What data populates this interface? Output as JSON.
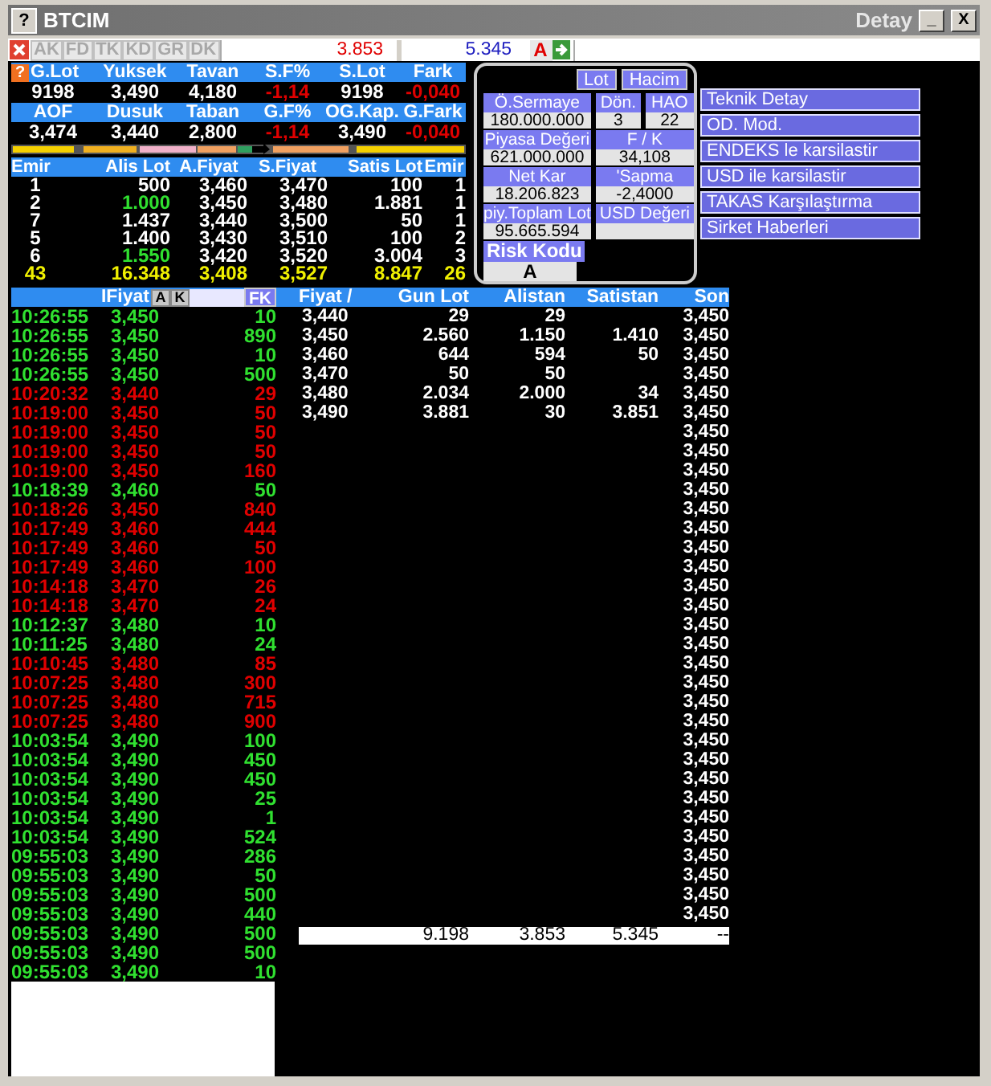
{
  "window": {
    "title": "BTCIM",
    "subtitle": "Detay",
    "help_icon": "?",
    "minimize": "_",
    "close": "X"
  },
  "toolbar": {
    "tabs": [
      {
        "label": "AK",
        "disabled": true
      },
      {
        "label": "FD",
        "disabled": true
      },
      {
        "label": "TK",
        "disabled": true
      },
      {
        "label": "KD",
        "disabled": true
      },
      {
        "label": "GR",
        "disabled": true
      },
      {
        "label": "DK",
        "disabled": true
      }
    ],
    "field_1": "3.853",
    "field_2": "5.345",
    "badge": "A"
  },
  "stats": {
    "help": "?",
    "rows": [
      {
        "headers": [
          "G.Lot",
          "Yuksek",
          "Tavan",
          "S.F%",
          "S.Lot",
          "Fark"
        ],
        "values": [
          "9198",
          "3,490",
          "4,180",
          "-1,14",
          "9198",
          "-0,040"
        ],
        "negative": [
          false,
          false,
          false,
          true,
          false,
          true
        ]
      },
      {
        "headers": [
          "AOF",
          "Dusuk",
          "Taban",
          "G.F%",
          "OG.Kap.",
          "G.Fark"
        ],
        "values": [
          "3,474",
          "3,440",
          "2,800",
          "-1,14",
          "3,490",
          "-0,040"
        ],
        "negative": [
          false,
          false,
          false,
          true,
          false,
          true
        ]
      }
    ]
  },
  "depth": {
    "columns": [
      "Emir",
      "Alis Lot",
      "A.Fiyat",
      "S.Fiyat",
      "Satis Lot",
      "Emir"
    ],
    "rows": [
      {
        "cells": [
          "1",
          "500",
          "3,460",
          "3,470",
          "100",
          "1"
        ],
        "changed": false
      },
      {
        "cells": [
          "2",
          "1.000",
          "3,450",
          "3,480",
          "1.881",
          "1"
        ],
        "changed": true
      },
      {
        "cells": [
          "7",
          "1.437",
          "3,440",
          "3,500",
          "50",
          "1"
        ],
        "changed": false
      },
      {
        "cells": [
          "5",
          "1.400",
          "3,430",
          "3,510",
          "100",
          "2"
        ],
        "changed": false
      },
      {
        "cells": [
          "6",
          "1.550",
          "3,420",
          "3,520",
          "3.004",
          "3"
        ],
        "changed": true
      }
    ],
    "totals": [
      "43",
      "16.348",
      "3,408",
      "3,527",
      "8.847",
      "26"
    ]
  },
  "info": {
    "buttons": [
      {
        "label": "Lot",
        "selected": false
      },
      {
        "label": "Hacim",
        "selected": false
      }
    ],
    "fields": [
      {
        "label": "Ö.Sermaye",
        "value": "180.000.000"
      },
      {
        "label": "Dön.",
        "value": "3"
      },
      {
        "label": "HAO",
        "value": "22"
      },
      {
        "label": "Piyasa Değeri",
        "value": "621.000.000"
      },
      {
        "label": "F / K",
        "value": "34,108"
      },
      {
        "label": "Net Kar",
        "value": "18.206.823"
      },
      {
        "label": "'Sapma",
        "value": "-2,4000"
      },
      {
        "label": "piy.Toplam Lot",
        "value": "95.665.594"
      },
      {
        "label": "USD Değeri"
      }
    ],
    "risk_label": "Risk Kodu",
    "risk_value": "A"
  },
  "menu": [
    "Teknik Detay",
    "OD. Mod.",
    "ENDEKS le karsilastir",
    "USD ile karsilastir",
    "TAKAS Karşılaştırma",
    "Sirket Haberleri"
  ],
  "trades": {
    "header": "IFiyat",
    "a_button": "A",
    "k_button": "K",
    "fk_button": "FK",
    "rows": [
      {
        "time": "10:26:55",
        "price": "3,450",
        "lot": "10",
        "kind": "buy"
      },
      {
        "time": "10:26:55",
        "price": "3,450",
        "lot": "890",
        "kind": "buy"
      },
      {
        "time": "10:26:55",
        "price": "3,450",
        "lot": "10",
        "kind": "buy"
      },
      {
        "time": "10:26:55",
        "price": "3,450",
        "lot": "500",
        "kind": "buy"
      },
      {
        "time": "10:20:32",
        "price": "3,440",
        "lot": "29",
        "kind": "sell"
      },
      {
        "time": "10:19:00",
        "price": "3,450",
        "lot": "50",
        "kind": "sell"
      },
      {
        "time": "10:19:00",
        "price": "3,450",
        "lot": "50",
        "kind": "sell"
      },
      {
        "time": "10:19:00",
        "price": "3,450",
        "lot": "50",
        "kind": "sell"
      },
      {
        "time": "10:19:00",
        "price": "3,450",
        "lot": "160",
        "kind": "sell"
      },
      {
        "time": "10:18:39",
        "price": "3,460",
        "lot": "50",
        "kind": "buy"
      },
      {
        "time": "10:18:26",
        "price": "3,450",
        "lot": "840",
        "kind": "sell"
      },
      {
        "time": "10:17:49",
        "price": "3,460",
        "lot": "444",
        "kind": "sell"
      },
      {
        "time": "10:17:49",
        "price": "3,460",
        "lot": "50",
        "kind": "sell"
      },
      {
        "time": "10:17:49",
        "price": "3,460",
        "lot": "100",
        "kind": "sell"
      },
      {
        "time": "10:14:18",
        "price": "3,470",
        "lot": "26",
        "kind": "sell"
      },
      {
        "time": "10:14:18",
        "price": "3,470",
        "lot": "24",
        "kind": "sell"
      },
      {
        "time": "10:12:37",
        "price": "3,480",
        "lot": "10",
        "kind": "buy"
      },
      {
        "time": "10:11:25",
        "price": "3,480",
        "lot": "24",
        "kind": "buy"
      },
      {
        "time": "10:10:45",
        "price": "3,480",
        "lot": "85",
        "kind": "sell"
      },
      {
        "time": "10:07:25",
        "price": "3,480",
        "lot": "300",
        "kind": "sell"
      },
      {
        "time": "10:07:25",
        "price": "3,480",
        "lot": "715",
        "kind": "sell"
      },
      {
        "time": "10:07:25",
        "price": "3,480",
        "lot": "900",
        "kind": "sell"
      },
      {
        "time": "10:03:54",
        "price": "3,490",
        "lot": "100",
        "kind": "buy"
      },
      {
        "time": "10:03:54",
        "price": "3,490",
        "lot": "450",
        "kind": "buy"
      },
      {
        "time": "10:03:54",
        "price": "3,490",
        "lot": "450",
        "kind": "buy"
      },
      {
        "time": "10:03:54",
        "price": "3,490",
        "lot": "25",
        "kind": "buy"
      },
      {
        "time": "10:03:54",
        "price": "3,490",
        "lot": "1",
        "kind": "buy"
      },
      {
        "time": "10:03:54",
        "price": "3,490",
        "lot": "524",
        "kind": "buy"
      },
      {
        "time": "09:55:03",
        "price": "3,490",
        "lot": "286",
        "kind": "buy"
      },
      {
        "time": "09:55:03",
        "price": "3,490",
        "lot": "50",
        "kind": "buy"
      },
      {
        "time": "09:55:03",
        "price": "3,490",
        "lot": "500",
        "kind": "buy"
      },
      {
        "time": "09:55:03",
        "price": "3,490",
        "lot": "440",
        "kind": "buy"
      },
      {
        "time": "09:55:03",
        "price": "3,490",
        "lot": "500",
        "kind": "buy"
      },
      {
        "time": "09:55:03",
        "price": "3,490",
        "lot": "500",
        "kind": "buy"
      },
      {
        "time": "09:55:03",
        "price": "3,490",
        "lot": "10",
        "kind": "buy"
      }
    ]
  },
  "price_table": {
    "columns": [
      "Fiyat /",
      "Gun Lot",
      "Alistan",
      "Satistan",
      "Son"
    ],
    "rows": [
      {
        "fiyat": "3,440",
        "gun_lot": "29",
        "alistan": "29",
        "son": "3,450"
      },
      {
        "fiyat": "3,450",
        "gun_lot": "2.560",
        "alistan": "1.150",
        "satistan": "1.410",
        "son": "3,450"
      },
      {
        "fiyat": "3,460",
        "gun_lot": "644",
        "alistan": "594",
        "satistan": "50",
        "son": "3,450"
      },
      {
        "fiyat": "3,470",
        "gun_lot": "50",
        "alistan": "50",
        "son": "3,450"
      },
      {
        "fiyat": "3,480",
        "gun_lot": "2.034",
        "alistan": "2.000",
        "satistan": "34",
        "son": "3,450"
      },
      {
        "fiyat": "3,490",
        "gun_lot": "3.881",
        "alistan": "30",
        "satistan": "3.851",
        "son": "3,450"
      },
      {
        "son": "3,450"
      },
      {
        "son": "3,450"
      },
      {
        "son": "3,450"
      },
      {
        "son": "3,450"
      },
      {
        "son": "3,450"
      },
      {
        "son": "3,450"
      },
      {
        "son": "3,450"
      },
      {
        "son": "3,450"
      },
      {
        "son": "3,450"
      },
      {
        "son": "3,450"
      },
      {
        "son": "3,450"
      },
      {
        "son": "3,450"
      },
      {
        "son": "3,450"
      },
      {
        "son": "3,450"
      },
      {
        "son": "3,450"
      },
      {
        "son": "3,450"
      },
      {
        "son": "3,450"
      },
      {
        "son": "3,450"
      },
      {
        "son": "3,450"
      },
      {
        "son": "3,450"
      },
      {
        "son": "3,450"
      },
      {
        "son": "3,450"
      },
      {
        "son": "3,450"
      },
      {
        "son": "3,450"
      },
      {
        "son": "3,450"
      },
      {
        "son": "3,450"
      }
    ],
    "totals": {
      "gun_lot": "9.198",
      "alistan": "3.853",
      "satistan": "5.345",
      "son": "--"
    }
  }
}
